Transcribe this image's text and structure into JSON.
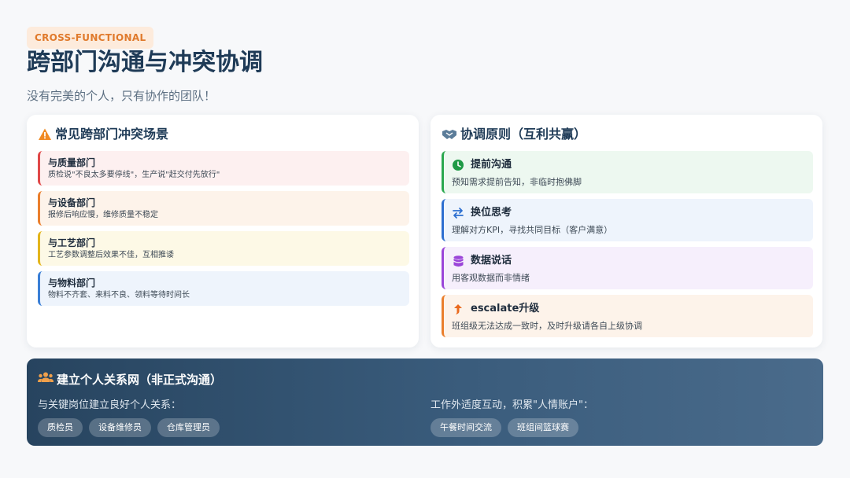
{
  "header": {
    "tag": "CROSS-FUNCTIONAL",
    "title": "跨部门沟通与冲突协调",
    "subtitle": "没有完美的个人，只有协作的团队！"
  },
  "conflicts": {
    "title": "常见跨部门冲突场景",
    "icon": "warning-icon",
    "items": [
      {
        "title": "与质量部门",
        "desc": "质检说\"不良太多要停线\"，生产说\"赶交付先放行\"",
        "accent": "#e04848",
        "bg": "#fdf0f0"
      },
      {
        "title": "与设备部门",
        "desc": "报修后响应慢，维修质量不稳定",
        "accent": "#ea7f2d",
        "bg": "#fdf3ea"
      },
      {
        "title": "与工艺部门",
        "desc": "工艺参数调整后效果不佳，互相推诿",
        "accent": "#e3b51c",
        "bg": "#fdf9e6"
      },
      {
        "title": "与物料部门",
        "desc": "物料不齐套、来料不良、领料等待时间长",
        "accent": "#3a7fd6",
        "bg": "#eef4fc"
      }
    ]
  },
  "principles": {
    "title": "协调原则（互利共赢）",
    "icon": "handshake-icon",
    "items": [
      {
        "title": "提前沟通",
        "desc": "预知需求提前告知，非临时抱佛脚",
        "icon": "clock-icon",
        "accent": "#2aa84f",
        "bg": "#edf8f0"
      },
      {
        "title": "换位思考",
        "desc": "理解对方KPI，寻找共同目标（客户满意）",
        "icon": "swap-icon",
        "accent": "#2d6fd0",
        "bg": "#eef4fc"
      },
      {
        "title": "数据说话",
        "desc": "用客观数据而非情绪",
        "icon": "database-icon",
        "accent": "#9b45d9",
        "bg": "#f6effc"
      },
      {
        "title": "escalate升级",
        "desc": "班组级无法达成一致时，及时升级请各自上级协调",
        "icon": "arrow-up-icon",
        "accent": "#ea7f2d",
        "bg": "#fdf3ea"
      }
    ]
  },
  "network": {
    "title": "建立个人关系网（非正式沟通）",
    "icon": "users-icon",
    "left": {
      "label": "与关键岗位建立良好个人关系：",
      "chips": [
        "质检员",
        "设备维修员",
        "仓库管理员"
      ]
    },
    "right": {
      "label": "工作外适度互动，积累\"人情账户\"：",
      "chips": [
        "午餐时间交流",
        "班组间篮球赛"
      ]
    }
  }
}
